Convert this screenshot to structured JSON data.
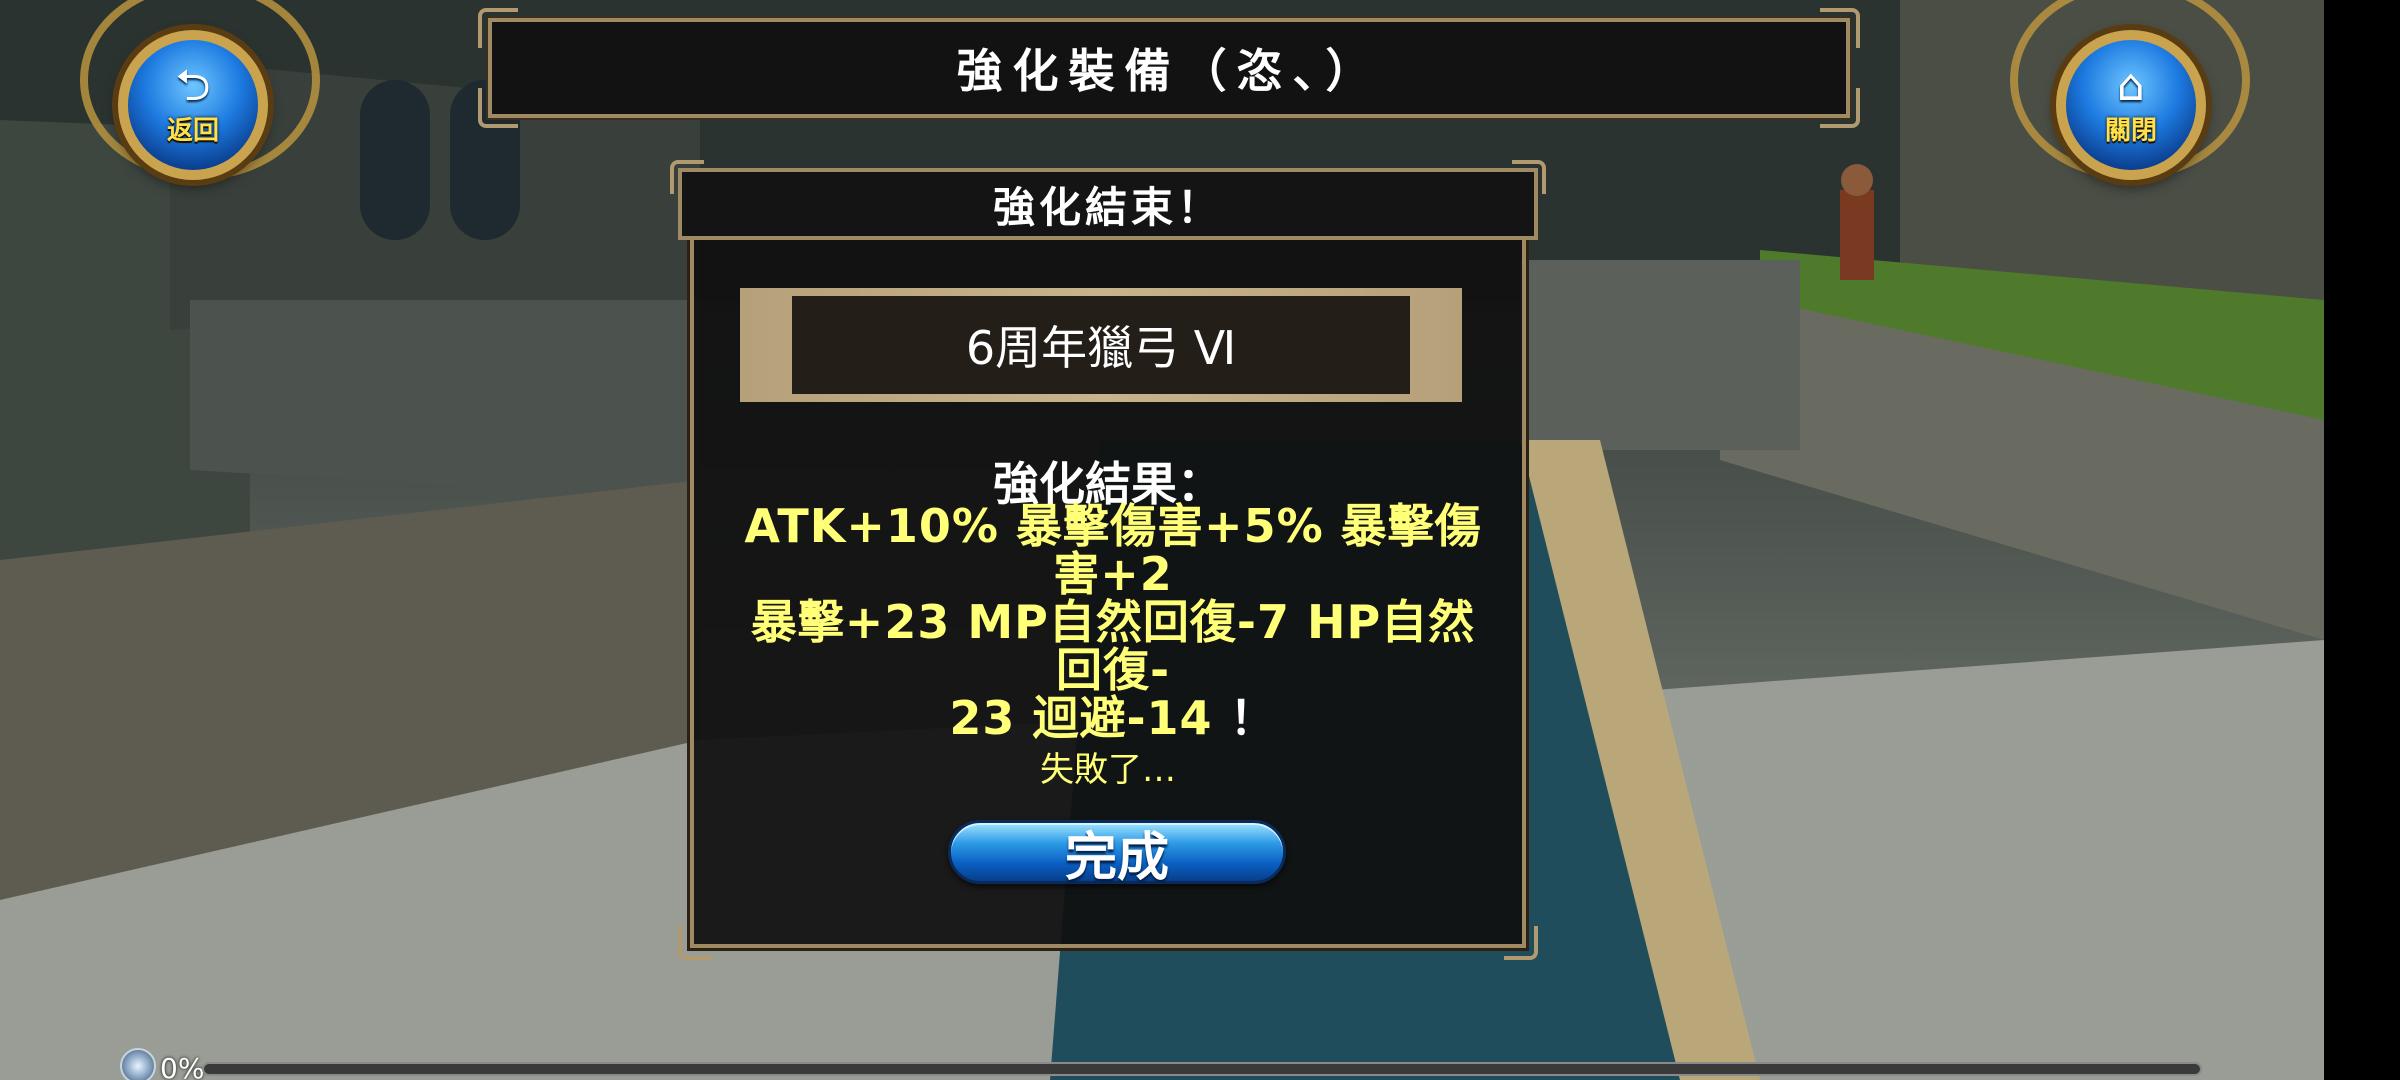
{
  "header": {
    "title": "強化裝備（恣、）"
  },
  "nav": {
    "back": {
      "glyph": "⮌",
      "label": "返回"
    },
    "close": {
      "glyph": "⌂",
      "label": "關閉"
    }
  },
  "dialog": {
    "title": "強化結束！",
    "item_name": "6周年獵弓 Ⅵ",
    "result_label": "強化結果：",
    "result_lines": [
      "ATK+10% 暴擊傷害+5% 暴擊傷害+2",
      "暴擊+23 MP自然回復-7 HP自然回復-",
      "23 迴避-14"
    ],
    "result_end": "！",
    "status": "失敗了…",
    "done_label": "完成"
  },
  "footer": {
    "progress_text": "0%",
    "progress": 0
  },
  "colors": {
    "accent_gold": "#ffff78",
    "frame": "#a08a64",
    "button_blue": "#2d9ae6"
  }
}
